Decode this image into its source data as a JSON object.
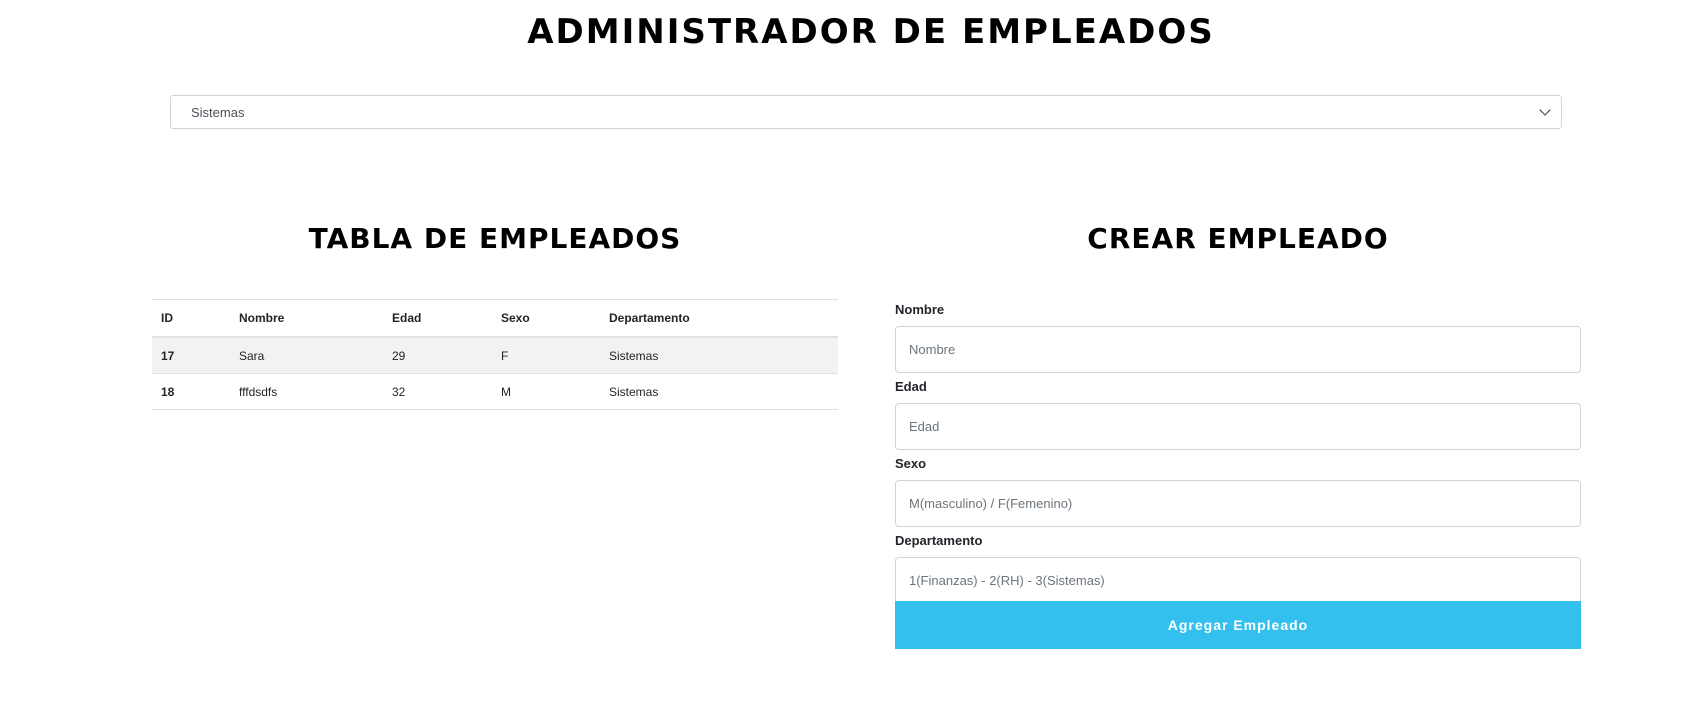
{
  "header": {
    "title": "ADMINISTRADOR DE EMPLEADOS"
  },
  "department_filter": {
    "selected": "Sistemas"
  },
  "table_section": {
    "title": "TABLA DE EMPLEADOS",
    "columns": [
      "ID",
      "Nombre",
      "Edad",
      "Sexo",
      "Departamento"
    ],
    "rows": [
      {
        "id": "17",
        "nombre": "Sara",
        "edad": "29",
        "sexo": "F",
        "departamento": "Sistemas"
      },
      {
        "id": "18",
        "nombre": "fffdsdfs",
        "edad": "32",
        "sexo": "M",
        "departamento": "Sistemas"
      }
    ]
  },
  "form_section": {
    "title": "CREAR EMPLEADO",
    "fields": {
      "nombre": {
        "label": "Nombre",
        "placeholder": "Nombre",
        "value": ""
      },
      "edad": {
        "label": "Edad",
        "placeholder": "Edad",
        "value": ""
      },
      "sexo": {
        "label": "Sexo",
        "placeholder": "M(masculino) / F(Femenino)",
        "value": ""
      },
      "departamento": {
        "label": "Departamento",
        "placeholder": "1(Finanzas) - 2(RH) - 3(Sistemas)",
        "value": ""
      }
    },
    "submit_label": "Agregar Empleado"
  },
  "colors": {
    "accent": "#33c0ee",
    "stripe": "#f2f2f2",
    "border": "#dee2e6"
  }
}
